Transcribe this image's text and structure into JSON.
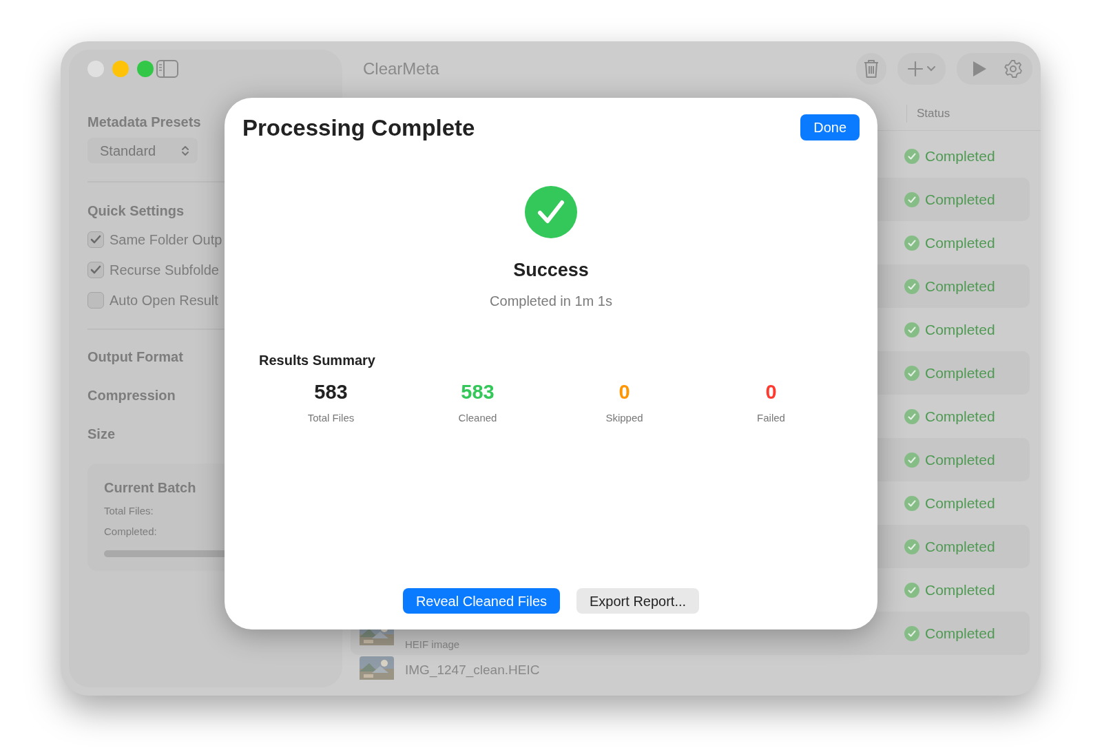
{
  "window": {
    "title": "ClearMeta",
    "traffic_lights": [
      {
        "color": "#e0e0e0"
      },
      {
        "color": "#fec309"
      },
      {
        "color": "#33c748"
      }
    ]
  },
  "sidebar": {
    "presets_title": "Metadata Presets",
    "preset": "Standard",
    "quick_title": "Quick Settings",
    "options": [
      {
        "label": "Same Folder Outp",
        "checked": true
      },
      {
        "label": "Recurse Subfolde",
        "checked": true
      },
      {
        "label": "Auto Open Result",
        "checked": false
      }
    ],
    "sections": [
      "Output Format",
      "Compression",
      "Size"
    ],
    "batch": {
      "title": "Current Batch",
      "lines": [
        "Total Files:",
        "Completed:"
      ]
    }
  },
  "list": {
    "columns": [
      "Status"
    ],
    "rows": [
      {
        "status": "Completed"
      },
      {
        "status": "Completed"
      },
      {
        "status": "Completed"
      },
      {
        "status": "Completed"
      },
      {
        "status": "Completed"
      },
      {
        "status": "Completed"
      },
      {
        "status": "Completed"
      },
      {
        "status": "Completed"
      },
      {
        "status": "Completed"
      },
      {
        "status": "Completed"
      },
      {
        "status": "Completed"
      },
      {
        "type": "HEIF image",
        "status": "Completed"
      },
      {
        "name": "IMG_1247_clean.HEIC"
      }
    ]
  },
  "dialog": {
    "title": "Processing Complete",
    "done": "Done",
    "result": "Success",
    "duration": "Completed in 1m 1s",
    "summary_title": "Results Summary",
    "stats": [
      {
        "value": "583",
        "label": "Total Files",
        "color": "#222222"
      },
      {
        "value": "583",
        "label": "Cleaned",
        "color": "#34c759"
      },
      {
        "value": "0",
        "label": "Skipped",
        "color": "#ff9500"
      },
      {
        "value": "0",
        "label": "Failed",
        "color": "#ff3b30"
      }
    ],
    "buttons": [
      {
        "label": "Reveal Cleaned Files",
        "primary": true
      },
      {
        "label": "Export Report...",
        "primary": false
      }
    ]
  }
}
